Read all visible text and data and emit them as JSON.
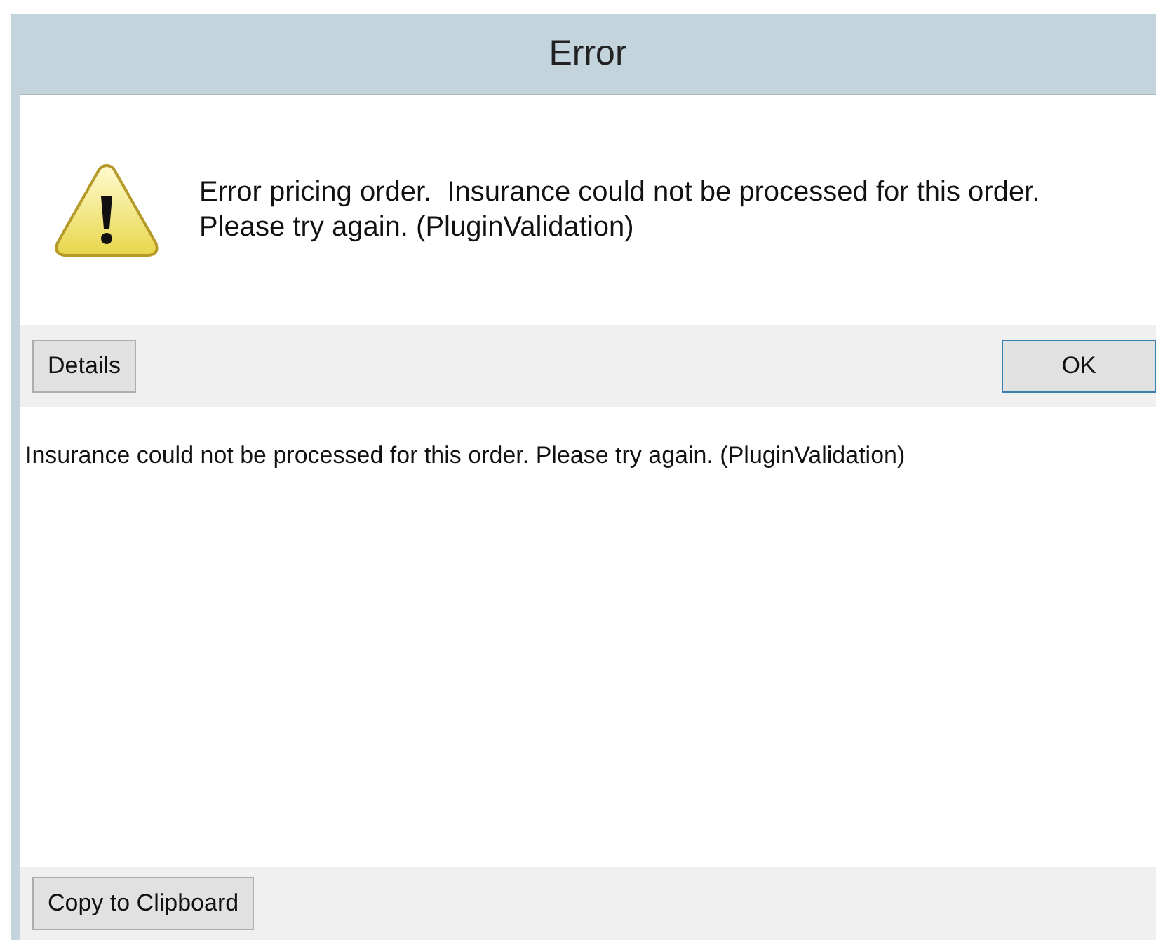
{
  "window": {
    "title": "Error"
  },
  "message": "Error pricing order.  Insurance could not be processed for this order. Please try again. (PluginValidation)",
  "details_button": "Details",
  "ok_button": "OK",
  "details_text": "Insurance could not be processed for this order. Please try again. (PluginValidation)",
  "copy_button": "Copy to Clipboard"
}
